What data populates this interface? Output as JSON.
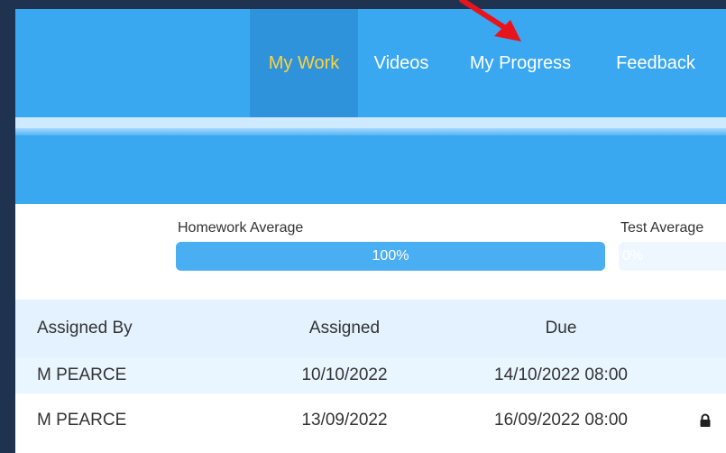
{
  "nav": {
    "items": [
      {
        "label": "My Work"
      },
      {
        "label": "Videos"
      },
      {
        "label": "My Progress"
      },
      {
        "label": "Feedback"
      }
    ]
  },
  "averages": {
    "homework_label": "Homework Average",
    "homework_value": "100%",
    "homework_fraction": 1.0,
    "test_label": "Test Average",
    "test_value": "0%",
    "test_fraction": 0.0
  },
  "table": {
    "headers": [
      "Assigned By",
      "Assigned",
      "Due"
    ],
    "rows": [
      {
        "assigned_by": "M PEARCE",
        "assigned": "10/10/2022",
        "due": "14/10/2022 08:00",
        "locked": false
      },
      {
        "assigned_by": "M PEARCE",
        "assigned": "13/09/2022",
        "due": "16/09/2022 08:00",
        "locked": true
      }
    ]
  },
  "colors": {
    "nav_bg": "#3aa8f0",
    "nav_active_text": "#ffd33a",
    "annotation_arrow": "#e8141c"
  },
  "icons": {
    "lock": "lock-icon",
    "arrow": "red-arrow-annotation"
  }
}
